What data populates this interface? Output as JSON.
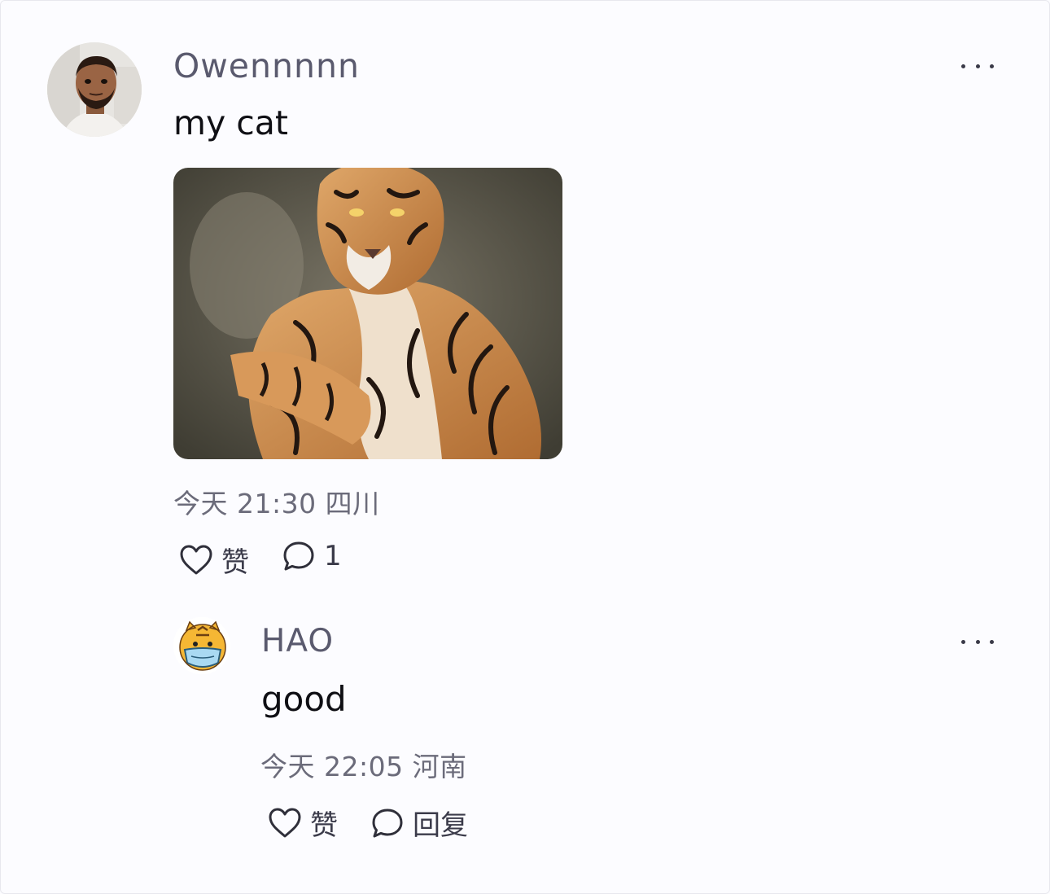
{
  "post": {
    "author": "Owennnnn",
    "avatar_icon": "user-avatar-photo",
    "text": "my cat",
    "image_icon": "tiger-photo",
    "time": "今天 21:30",
    "location": "四川",
    "like_label": "赞",
    "comment_count": "1"
  },
  "reply": {
    "author": "HAO",
    "avatar_icon": "tiger-cartoon-avatar",
    "text": "good",
    "time": "今天 22:05",
    "location": "河南",
    "like_label": "赞",
    "reply_label": "回复"
  },
  "colors": {
    "background": "#fcfcff",
    "name_text": "#5a5a6e",
    "meta_text": "#6b6b7a"
  }
}
